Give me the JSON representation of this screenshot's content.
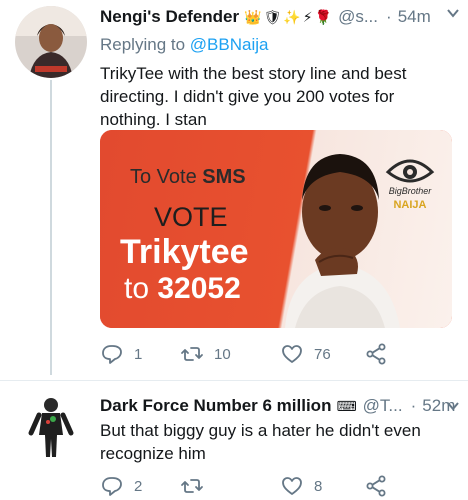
{
  "tweets": [
    {
      "display_name": "Nengi's Defender",
      "emojis": [
        "👑",
        "🛡",
        "✨",
        "⚡",
        "🌹"
      ],
      "handle": "@s...",
      "dot": "·",
      "time": "54m",
      "reply_prefix": "Replying to",
      "reply_mention": "@BBNaija",
      "text": "TrikyTee with the best story line and best directing. I didn't give you 200 votes for nothing. I stan",
      "media": {
        "sms_prefix": "To Vote",
        "sms_bold": "SMS",
        "vote": "VOTE",
        "name": "Trikytee",
        "to": "to",
        "number": "32052",
        "logo_line1": "BigBrother",
        "logo_line2": "NAIJA"
      },
      "reply_count": "1",
      "retweet_count": "10",
      "like_count": "76"
    },
    {
      "display_name": "Dark Force Number 6 million",
      "emojis": [
        "⌨"
      ],
      "handle": "@T...",
      "dot": "·",
      "time": "52m",
      "text": "But that biggy guy is a hater he didn't even recognize him",
      "reply_count": "2",
      "retweet_count": "",
      "like_count": "8"
    }
  ]
}
